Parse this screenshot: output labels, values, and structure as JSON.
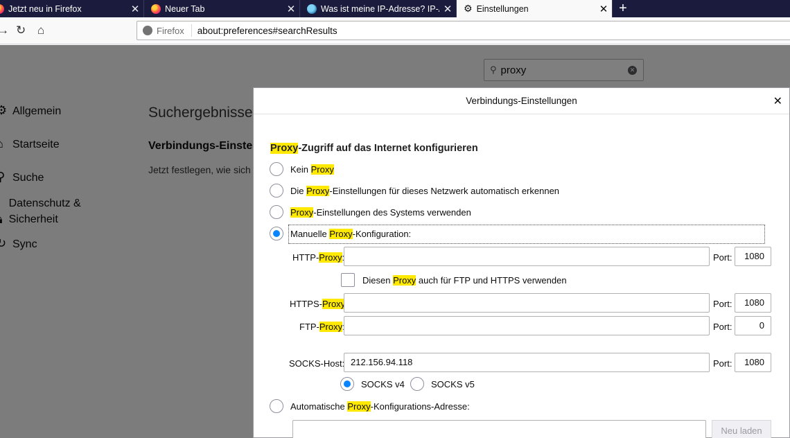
{
  "tabs": [
    {
      "label": "Jetzt neu in Firefox"
    },
    {
      "label": "Neuer Tab"
    },
    {
      "label": "Was ist meine IP-Adresse? IP-A"
    },
    {
      "label": "Einstellungen"
    }
  ],
  "toolbar": {
    "identity": "Firefox",
    "url": "about:preferences#searchResults"
  },
  "search": {
    "value": "proxy"
  },
  "sidebar": {
    "items": [
      {
        "label": "Allgemein"
      },
      {
        "label": "Startseite"
      },
      {
        "label": "Suche"
      },
      {
        "label": "Datenschutz & Sicherheit"
      },
      {
        "label": "Sync"
      }
    ]
  },
  "results": {
    "title": "Suchergebnisse",
    "heading": "Verbindungs-Einste",
    "text": "Jetzt festlegen, wie sich"
  },
  "dialog": {
    "title": "Verbindungs-Einstellungen",
    "section": {
      "hl": "Proxy",
      "rest": "-Zugriff auf das Internet konfigurieren"
    },
    "options": {
      "none": {
        "a": "Kein ",
        "hl": "Proxy",
        "b": ""
      },
      "auto_detect": {
        "a": "Die ",
        "hl": "Proxy",
        "b": "-Einstellungen für dieses Netzwerk automatisch erkennen"
      },
      "system": {
        "a": "",
        "hl": "Proxy",
        "b": "-Einstellungen des Systems verwenden"
      },
      "manual": {
        "a": "Manuelle ",
        "hl": "Proxy",
        "b": "-Konfiguration:",
        "selected": true
      },
      "pac": {
        "a": "Automatische ",
        "hl": "Proxy",
        "b": "-Konfigurations-Adresse:"
      }
    },
    "http": {
      "a": "HTTP-",
      "hl": "Proxy",
      "b": ":",
      "value": "",
      "port_label": "Port:",
      "port": "1080"
    },
    "also_use": {
      "a": "Diesen ",
      "hl": "Proxy",
      "b": " auch für FTP und HTTPS verwenden",
      "checked": false
    },
    "https": {
      "a": "HTTPS-",
      "hl": "Proxy",
      "b": "",
      "value": "",
      "port_label": "Port:",
      "port": "1080"
    },
    "ftp": {
      "a": "FTP-",
      "hl": "Proxy",
      "b": ":",
      "value": "",
      "port_label": "Port:",
      "port": "0"
    },
    "socks": {
      "label": "SOCKS-Host:",
      "value": "212.156.94.118",
      "port_label": "Port:",
      "port": "1080"
    },
    "socks_v4": {
      "label": "SOCKS v4",
      "selected": true
    },
    "socks_v5": {
      "label": "SOCKS v5",
      "selected": false
    },
    "pac_url": "",
    "reload_label": "Neu laden"
  }
}
